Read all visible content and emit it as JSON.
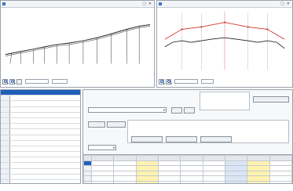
{
  "profile_window": {
    "toolbar": {
      "field1_label": "",
      "field2_label": ""
    }
  },
  "section_window": {
    "toolbar": {
      "field1_label": "",
      "field2_label": ""
    }
  },
  "left_list": {
    "rows": [
      "",
      "",
      "",
      "",
      "",
      "",
      "",
      "",
      "",
      "",
      "",
      "",
      "",
      "",
      "",
      "",
      ""
    ]
  },
  "edit_panel": {
    "info_line1": "",
    "info_line2": "",
    "line_combo_value": "",
    "right_info_1": "",
    "right_info_2": "",
    "right_info_3": "",
    "right_button": "",
    "edit_button": "",
    "edit_button_2": "",
    "mode_label": "",
    "type_combo_value": "",
    "table": {
      "headers": [
        "",
        "",
        "",
        "",
        "",
        "",
        "",
        "",
        "",
        ""
      ],
      "rows": [
        [
          "",
          "",
          "",
          "",
          "",
          "",
          "",
          "",
          "",
          ""
        ],
        [
          "",
          "",
          "",
          "",
          "",
          "",
          "",
          "",
          "",
          ""
        ],
        [
          "",
          "",
          "",
          "",
          "",
          "",
          "",
          "",
          "",
          ""
        ],
        [
          "",
          "",
          "",
          "",
          "",
          "",
          "",
          "",
          "",
          ""
        ],
        [
          "",
          "",
          "",
          "",
          "",
          "",
          "",
          "",
          "",
          ""
        ]
      ]
    }
  }
}
